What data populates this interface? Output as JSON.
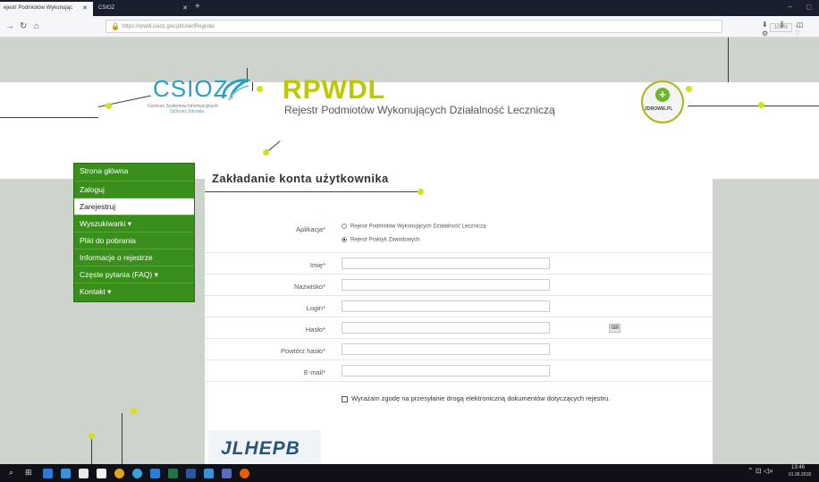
{
  "browser": {
    "tabs": [
      {
        "label": "ejestr Podmiotów Wykonując",
        "close": "✕"
      },
      {
        "label": "CSIOZ",
        "close": "✕"
      }
    ],
    "new_tab": "+",
    "url": "https://rpwdl.csioz.gov.pl/User/Register",
    "zoom": "100%",
    "url_actions": "··· ♡ ☆",
    "toolbar_icons": "⬇ ⫼ ◫ ⚙"
  },
  "header": {
    "csioz_logo": "CSIOZ",
    "csioz_line1": "Centrum Systemów Informacyjnych",
    "csioz_line2": "Ochrony Zdrowia",
    "rpwdl_logo": "RPWDL",
    "rpwdl_subtitle": "Rejestr Podmiotów Wykonujących Działalność Leczniczą",
    "badge_text": "ZDROWIE.PL"
  },
  "sidebar": {
    "items": [
      {
        "label": "Strona główna"
      },
      {
        "label": "Zaloguj"
      },
      {
        "label": "Zarejestruj"
      },
      {
        "label": "Wyszukiwarki ▾"
      },
      {
        "label": "Pliki do pobrania"
      },
      {
        "label": "Informacje o rejestrze"
      },
      {
        "label": "Częste pytania (FAQ) ▾"
      },
      {
        "label": "Kontakt ▾"
      }
    ],
    "active_index": 2
  },
  "form": {
    "title": "Zakładanie konta użytkownika",
    "application_label": "Aplikacja",
    "application_options": [
      {
        "label": "Rejestr Podmiotów Wykonujących Działalność Leczniczą",
        "selected": false
      },
      {
        "label": "Rejestr Praktyk Zawodowych",
        "selected": true
      }
    ],
    "fields": [
      {
        "label": "Imię",
        "value": ""
      },
      {
        "label": "Nazwisko",
        "value": ""
      },
      {
        "label": "Login",
        "value": ""
      },
      {
        "label": "Hasło",
        "value": ""
      },
      {
        "label": "Powtórz hasło",
        "value": ""
      },
      {
        "label": "E-mail",
        "value": ""
      }
    ],
    "required_mark": "*",
    "keyboard_button": "⌨",
    "consent_label": "Wyrażam zgodę na przesyłanie drogą elektroniczną dokumentów dotyczących rejestru.",
    "captcha": "JLHEPB"
  },
  "taskbar": {
    "time": "13:46",
    "date": "01.06.2018"
  },
  "colors": {
    "accent": "#d4df1b",
    "menu_green": "#3a8e1c",
    "csioz_blue": "#2aa0c0"
  }
}
